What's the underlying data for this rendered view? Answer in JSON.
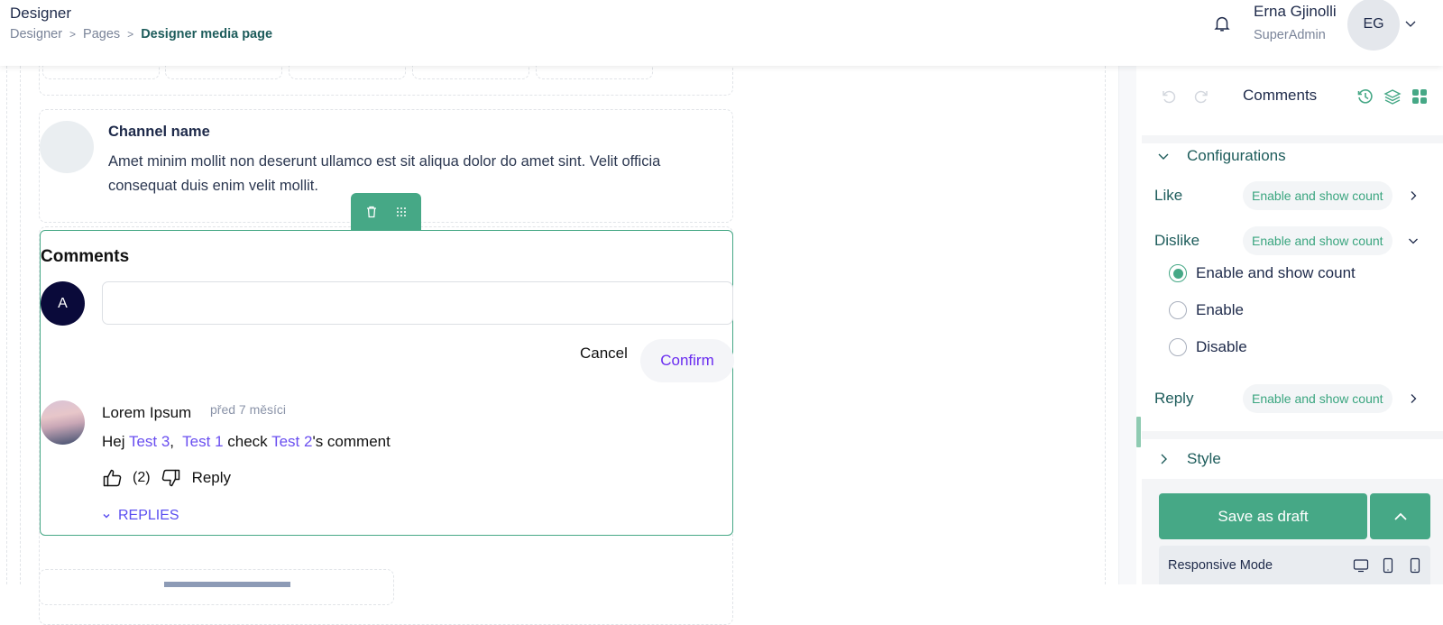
{
  "header": {
    "app_title": "Designer",
    "breadcrumb": [
      {
        "label": "Designer"
      },
      {
        "label": "Pages"
      },
      {
        "label": "Designer media page"
      }
    ],
    "user": {
      "name": "Erna Gjinolli",
      "role": "SuperAdmin",
      "initials": "EG"
    },
    "icons": {
      "notifications": "bell-icon",
      "user_menu": "chevron-down-icon"
    }
  },
  "canvas": {
    "channel": {
      "name": "Channel name",
      "description": "Amet minim mollit non deserunt ullamco est sit aliqua dolor do amet sint. Velit officia consequat duis enim velit mollit."
    },
    "widget_toolbar": {
      "icons": [
        "trash-icon",
        "drag-handle-icon"
      ]
    },
    "comments_widget": {
      "title": "Comments",
      "current_user_initial": "A",
      "input": {
        "value": "",
        "placeholder": ""
      },
      "cancel_label": "Cancel",
      "confirm_label": "Confirm",
      "comment": {
        "author": "Lorem Ipsum",
        "time": "před 7 měsíci",
        "text_parts": [
          {
            "text": "Hej ",
            "mention": false
          },
          {
            "text": "Test 3",
            "mention": true
          },
          {
            "text": ",  ",
            "mention": false
          },
          {
            "text": "Test 1",
            "mention": true
          },
          {
            "text": " check ",
            "mention": false
          },
          {
            "text": "Test 2",
            "mention": true
          },
          {
            "text": "'s comment",
            "mention": false
          }
        ],
        "like_count": "(2)",
        "reply_label": "Reply",
        "replies_label": "REPLIES"
      }
    }
  },
  "panel": {
    "title": "Comments",
    "icons": [
      "undo-icon",
      "redo-icon",
      "history-icon",
      "layers-icon",
      "grid-icon"
    ],
    "configurations": {
      "label": "Configurations",
      "rows": [
        {
          "label": "Like",
          "value": "Enable and show count",
          "expanded": false
        },
        {
          "label": "Dislike",
          "value": "Enable and show count",
          "expanded": true
        },
        {
          "label": "Reply",
          "value": "Enable and show count",
          "expanded": false
        }
      ],
      "dislike_options": [
        {
          "label": "Enable and show count",
          "selected": true
        },
        {
          "label": "Enable",
          "selected": false
        },
        {
          "label": "Disable",
          "selected": false
        }
      ]
    },
    "style": {
      "label": "Style"
    },
    "save_label": "Save as draft",
    "responsive_mode_label": "Responsive Mode",
    "responsive_icons": [
      "desktop-icon",
      "tablet-icon",
      "mobile-icon"
    ]
  },
  "colors": {
    "accent": "#46a886",
    "mention": "#6a4ff0",
    "confirm": "#6a2df0",
    "heading": "#1d5c5b"
  }
}
